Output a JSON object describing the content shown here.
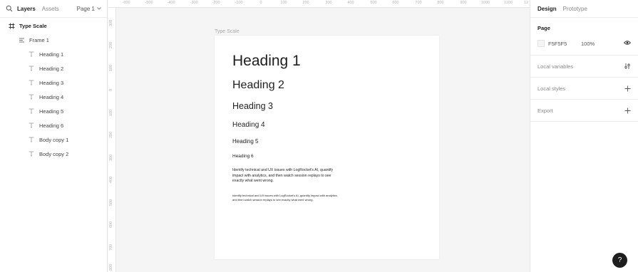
{
  "left_panel": {
    "tabs": {
      "layers": "Layers",
      "assets": "Assets"
    },
    "page_selector": "Page 1",
    "layers": [
      {
        "label": "Type Scale",
        "icon": "frame-icon"
      },
      {
        "label": "Frame 1",
        "icon": "auto-layout-icon"
      },
      {
        "label": "Heading 1",
        "icon": "text-icon"
      },
      {
        "label": "Heading 2",
        "icon": "text-icon"
      },
      {
        "label": "Heading 3",
        "icon": "text-icon"
      },
      {
        "label": "Heading 4",
        "icon": "text-icon"
      },
      {
        "label": "Heading 5",
        "icon": "text-icon"
      },
      {
        "label": "Heading 6",
        "icon": "text-icon"
      },
      {
        "label": "Body copy 1",
        "icon": "text-icon"
      },
      {
        "label": "Body copy 2",
        "icon": "text-icon"
      }
    ]
  },
  "rulers": {
    "top": [
      "-600",
      "-500",
      "-400",
      "-300",
      "-200",
      "-100",
      "0",
      "100",
      "200",
      "300",
      "400",
      "500",
      "600",
      "700",
      "800",
      "900",
      "1000",
      "1100",
      "12"
    ],
    "left": [
      "300",
      "200",
      "100",
      "0",
      "100",
      "200",
      "300",
      "400",
      "500",
      "600",
      "700",
      "800"
    ]
  },
  "canvas": {
    "background": "#F5F5F5",
    "frame_label": "Type Scale",
    "texts": {
      "h1": "Heading 1",
      "h2": "Heading 2",
      "h3": "Heading 3",
      "h4": "Heading 4",
      "h5": "Heading 5",
      "h6": "Heading 6",
      "body1": "Identify technical and UX issues with LogRocket's AI, quantify impact with analytics, and then watch session replays to see exactly what went wrong.",
      "body2": "Identify technical and UX issues with LogRocket's AI, quantify impact with analytics, and then watch session replays to see exactly what went wrong."
    }
  },
  "right_panel": {
    "tabs": {
      "design": "Design",
      "prototype": "Prototype"
    },
    "page": {
      "title": "Page",
      "hex": "F5F5F5",
      "opacity": "100%"
    },
    "local_variables": "Local variables",
    "local_styles": "Local styles",
    "export": "Export"
  },
  "help": "?"
}
